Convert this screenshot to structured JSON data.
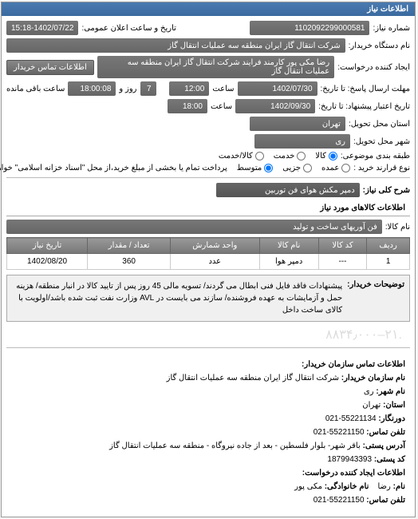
{
  "panel_title": "اطلاعات نیاز",
  "labels": {
    "need_no": "شماره نیاز:",
    "public_dt": "تاریخ و ساعت اعلان عمومی:",
    "buyer_org": "نام دستگاه خریدار:",
    "requester": "ایجاد کننده درخواست:",
    "contact_btn": "اطلاعات تماس خریدار",
    "deadline": "مهلت ارسال پاسخ: تا تاریخ:",
    "remain": "ساعت باقی مانده",
    "validity": "تاریخ اعتبار پیشنهاد: تا تاریخ:",
    "province": "استان محل تحویل:",
    "city": "شهر محل تحویل:",
    "cat": "طبقه بندی موضوعی:",
    "contract": "نوع قرارند خرید :",
    "contract_note": "پرداخت تمام یا بخشی از مبلغ خرید،از محل \"اسناد خزانه اسلامی\" خواهد بود.",
    "need_title": "شرح کلی نیاز:",
    "goods_info": "اطلاعات کالاهای مورد نیاز",
    "goods_name": "نام کالا:",
    "notes_lbl": "توضیحات خریدار:",
    "time_sep": "ساعت",
    "day_word": "روز و",
    "and": "و"
  },
  "values": {
    "need_no": "1102092299000581",
    "public_date": "1402/07/22",
    "public_time": "15:18",
    "buyer_org": "شرکت انتقال گاز ایران منطقه سه عملیات انتقال گاز",
    "requester": "رضا مکی پور کارمند فرایند شرکت انتقال گاز ایران منطقه سه عملیات انتقال گاز",
    "deadline_date": "1402/07/30",
    "deadline_time": "12:00",
    "remain_days": "7",
    "remain_time": "18:00:08",
    "validity_date": "1402/09/30",
    "validity_time": "18:00",
    "province": "تهران",
    "city": "ری",
    "need_title": "دمپر مکش هوای فن توربین",
    "goods_name": "فن آوریهای ساخت و تولید"
  },
  "cat_options": {
    "goods": "کالا",
    "service": "خدمت",
    "both": "کالا/خدمت"
  },
  "contract_options": {
    "average": "متوسط",
    "small": "جزیی",
    "large": "عمده"
  },
  "table": {
    "headers": {
      "row": "ردیف",
      "code": "کد کالا",
      "name": "نام کالا",
      "unit": "واحد شمارش",
      "qty": "تعداد / مقدار",
      "date": "تاریخ نیاز"
    },
    "rows": [
      {
        "row": "1",
        "code": "---",
        "name": "دمپر هوا",
        "unit": "عدد",
        "qty": "360",
        "date": "1402/08/20"
      }
    ]
  },
  "notes": "پیشنهادات فاقد فایل فنی ابطال می گردند/ تسویه مالی 45 روز پس از تایید کالا در انبار منطقه/ هزینه حمل و آزمایشات به عهده فروشنده/ سازند می بایست در AVL وزارت نفت ثبت شده باشد/اولویت با کالای ساخت داخل",
  "watermark": ".۲۱–۸۸۳۴٫۰۰۰",
  "contact": {
    "title": "اطلاعات تماس سازمان خریدار:",
    "org_lbl": "نام سازمان خریدار:",
    "org": "شرکت انتقال گاز ایران منطقه سه عملیات انتقال گاز",
    "city_lbl": "نام شهر:",
    "city": "ری",
    "prov_lbl": "استان:",
    "prov": "تهران",
    "fax_lbl": "دورنگار:",
    "fax": "55221134-021",
    "tel_lbl": "تلفن تماس:",
    "tel": "55221150-021",
    "addr_lbl": "آدرس پستی:",
    "addr": "باقر شهر- بلوار فلسطین - بعد از جاده نیروگاه - منطقه سه عملیات انتقال گاز",
    "zip_lbl": "کد پستی:",
    "zip": "1879943393",
    "req_title": "اطلاعات ایجاد کننده درخواست:",
    "name_lbl": "نام:",
    "name": "رضا",
    "lname_lbl": "نام خانوادگی:",
    "lname": "مکی پور",
    "ctel_lbl": "تلفن تماس:",
    "ctel": "55221150-021"
  }
}
